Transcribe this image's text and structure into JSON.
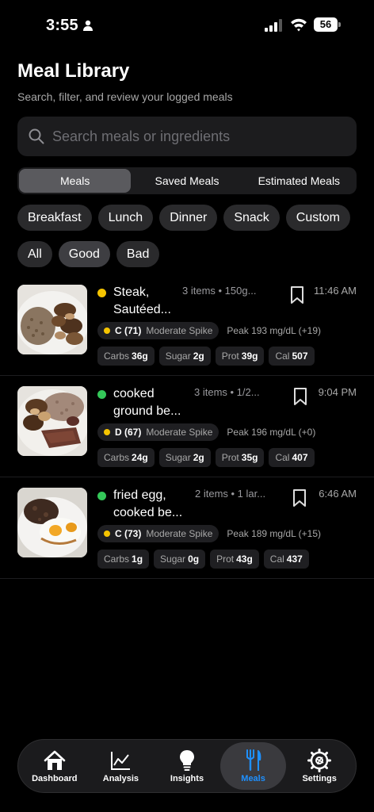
{
  "status_bar": {
    "time": "3:55",
    "battery": "56"
  },
  "header": {
    "title": "Meal Library",
    "subtitle": "Search, filter, and review your logged meals"
  },
  "search": {
    "placeholder": "Search meals or ingredients",
    "value": ""
  },
  "segments": [
    {
      "label": "Meals",
      "active": true
    },
    {
      "label": "Saved Meals",
      "active": false
    },
    {
      "label": "Estimated Meals",
      "active": false
    }
  ],
  "meal_type_chips": [
    "Breakfast",
    "Lunch",
    "Dinner",
    "Snack",
    "Custom"
  ],
  "quality_chips": [
    {
      "label": "All",
      "selected": false
    },
    {
      "label": "Good",
      "selected": true
    },
    {
      "label": "Bad",
      "selected": false
    }
  ],
  "meals": [
    {
      "name": "Steak,\nSautéed...",
      "items": "3 items • 150g...",
      "time": "11:46 AM",
      "status_color": "#f5c400",
      "grade": "C (71)",
      "spike": "Moderate Spike",
      "peak": "Peak 193 mg/dL (+19)",
      "carbs": "36g",
      "sugar": "2g",
      "prot": "39g",
      "cal": "507",
      "image": "steak-rice-mushrooms"
    },
    {
      "name": "cooked\nground be...",
      "items": "3 items • 1/2...",
      "time": "9:04 PM",
      "status_color": "#34c759",
      "grade": "D (67)",
      "spike": "Moderate Spike",
      "peak": "Peak 196 mg/dL (+0)",
      "carbs": "24g",
      "sugar": "2g",
      "prot": "35g",
      "cal": "407",
      "image": "ground-beef-mushrooms"
    },
    {
      "name": "fried egg,\ncooked be...",
      "items": "2 items • 1 lar...",
      "time": "6:46 AM",
      "status_color": "#34c759",
      "grade": "C (73)",
      "spike": "Moderate Spike",
      "peak": "Peak 189 mg/dL (+15)",
      "carbs": "1g",
      "sugar": "0g",
      "prot": "43g",
      "cal": "437",
      "image": "fried-egg-beef"
    }
  ],
  "macro_labels": {
    "carbs": "Carbs",
    "sugar": "Sugar",
    "prot": "Prot",
    "cal": "Cal"
  },
  "tabs": [
    {
      "label": "Dashboard",
      "icon": "house-icon",
      "active": false
    },
    {
      "label": "Analysis",
      "icon": "chart-line-icon",
      "active": false
    },
    {
      "label": "Insights",
      "icon": "lightbulb-icon",
      "active": false
    },
    {
      "label": "Meals",
      "icon": "fork-knife-icon",
      "active": true
    },
    {
      "label": "Settings",
      "icon": "gear-icon",
      "active": false
    }
  ],
  "colors": {
    "accent": "#1e90ff",
    "grade_dot": "#f5c400",
    "good": "#34c759"
  }
}
